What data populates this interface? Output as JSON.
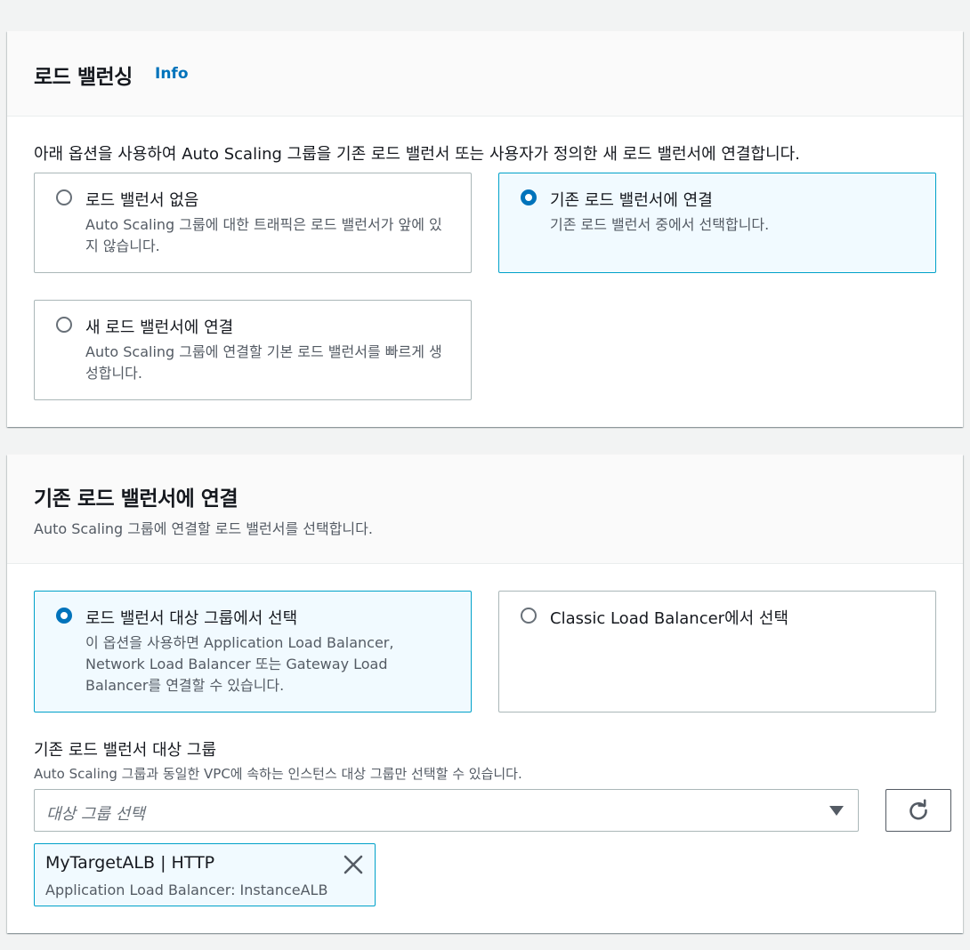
{
  "lb_section": {
    "title": "로드 밸런싱",
    "info": "Info",
    "description": "아래 옵션을 사용하여 Auto Scaling 그룹을 기존 로드 밸런서 또는 사용자가 정의한 새 로드 밸런서에 연결합니다.",
    "options": [
      {
        "label": "로드 밸런서 없음",
        "desc": "Auto Scaling 그룹에 대한 트래픽은 로드 밸런서가 앞에 있지 않습니다.",
        "selected": false
      },
      {
        "label": "기존 로드 밸런서에 연결",
        "desc": "기존 로드 밸런서 중에서 선택합니다.",
        "selected": true
      },
      {
        "label": "새 로드 밸런서에 연결",
        "desc": "Auto Scaling 그룹에 연결할 기본 로드 밸런서를 빠르게 생성합니다.",
        "selected": false
      }
    ]
  },
  "existing_section": {
    "title": "기존 로드 밸런서에 연결",
    "description": "Auto Scaling 그룹에 연결할 로드 밸런서를 선택합니다.",
    "options": [
      {
        "label": "로드 밸런서 대상 그룹에서 선택",
        "desc": "이 옵션을 사용하면 Application Load Balancer, Network Load Balancer 또는 Gateway Load Balancer를 연결할 수 있습니다.",
        "selected": true
      },
      {
        "label": "Classic Load Balancer에서 선택",
        "desc": "",
        "selected": false
      }
    ],
    "target_group_field": {
      "label": "기존 로드 밸런서 대상 그룹",
      "description": "Auto Scaling 그룹과 동일한 VPC에 속하는 인스턴스 대상 그룹만 선택할 수 있습니다.",
      "placeholder": "대상 그룹 선택"
    },
    "selected_token": {
      "title": "MyTargetALB | HTTP",
      "subtitle": "Application Load Balancer: InstanceALB"
    }
  },
  "icons": {
    "refresh": "refresh-icon",
    "dropdown": "caret-down-icon",
    "dismiss": "close-icon"
  },
  "colors": {
    "link": "#0073bb",
    "selected_border": "#00a1c9",
    "selected_bg": "#f1faff"
  }
}
